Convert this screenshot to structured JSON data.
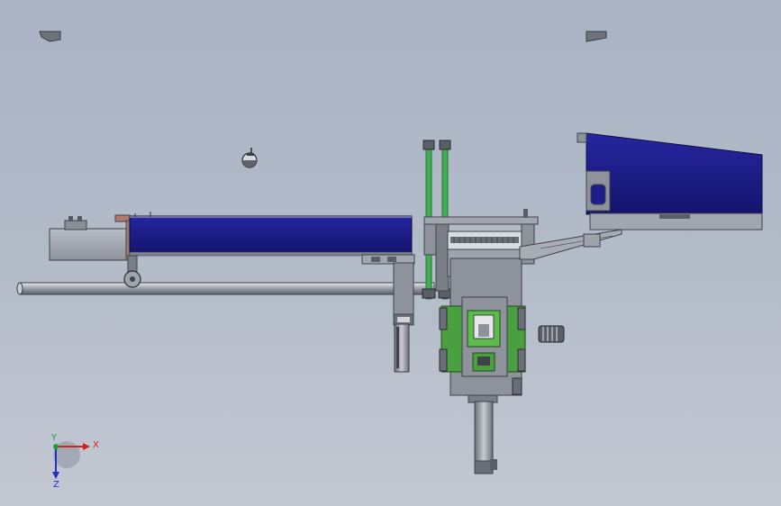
{
  "view": {
    "background_top": "#a9b3c4",
    "background_bottom": "#c3c8d2"
  },
  "triad": {
    "x_label": "X",
    "y_label": "Y",
    "z_label": "Z",
    "x_color": "#d42020",
    "y_color": "#20a030",
    "z_color": "#2030c8"
  },
  "colors": {
    "blue_panel": "#1e1e8a",
    "green_plate": "#4aa040",
    "green_rod": "#3fb04f",
    "metal": "#9aa0a8",
    "dark_metal": "#5a5e66"
  }
}
